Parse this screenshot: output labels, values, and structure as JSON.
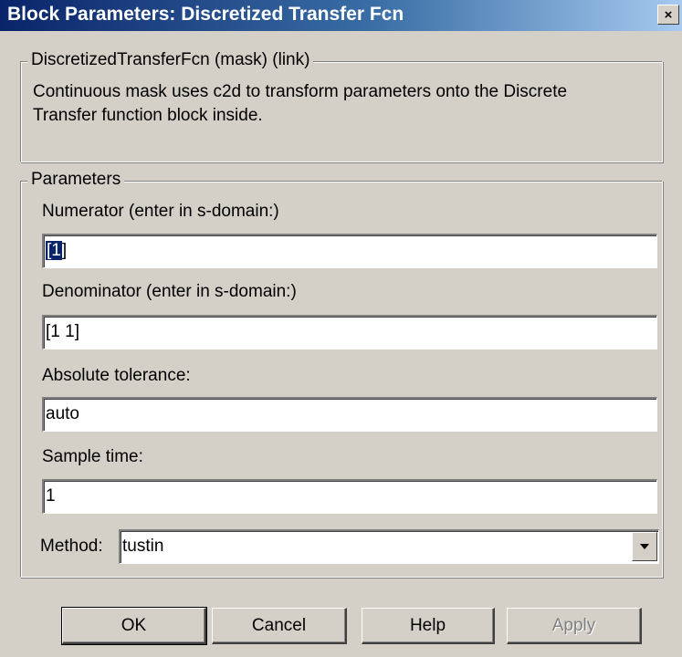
{
  "window": {
    "title": "Block Parameters: Discretized Transfer Fcn",
    "close_glyph": "×"
  },
  "description_group": {
    "legend": "DiscretizedTransferFcn (mask) (link)",
    "text": "Continuous mask uses c2d to transform parameters onto the Discrete Transfer function block inside."
  },
  "parameters_group": {
    "legend": "Parameters",
    "numerator": {
      "label": "Numerator (enter in s-domain:)",
      "value_selected": "[1",
      "value_rest": "]"
    },
    "denominator": {
      "label": "Denominator (enter in s-domain:)",
      "value": "[1 1]"
    },
    "absolute_tolerance": {
      "label": "Absolute tolerance:",
      "value": "auto"
    },
    "sample_time": {
      "label": "Sample time:",
      "value": "1"
    },
    "method": {
      "label": "Method:",
      "value": "tustin"
    }
  },
  "buttons": {
    "ok": "OK",
    "cancel": "Cancel",
    "help": "Help",
    "apply": "Apply"
  },
  "icons": {
    "close": "close-icon",
    "dropdown": "chevron-down-icon"
  },
  "colors": {
    "dialog_background": "#d4d0c8",
    "titlebar_start": "#0a246a",
    "titlebar_end": "#a6caf0",
    "selection": "#0a246a"
  }
}
